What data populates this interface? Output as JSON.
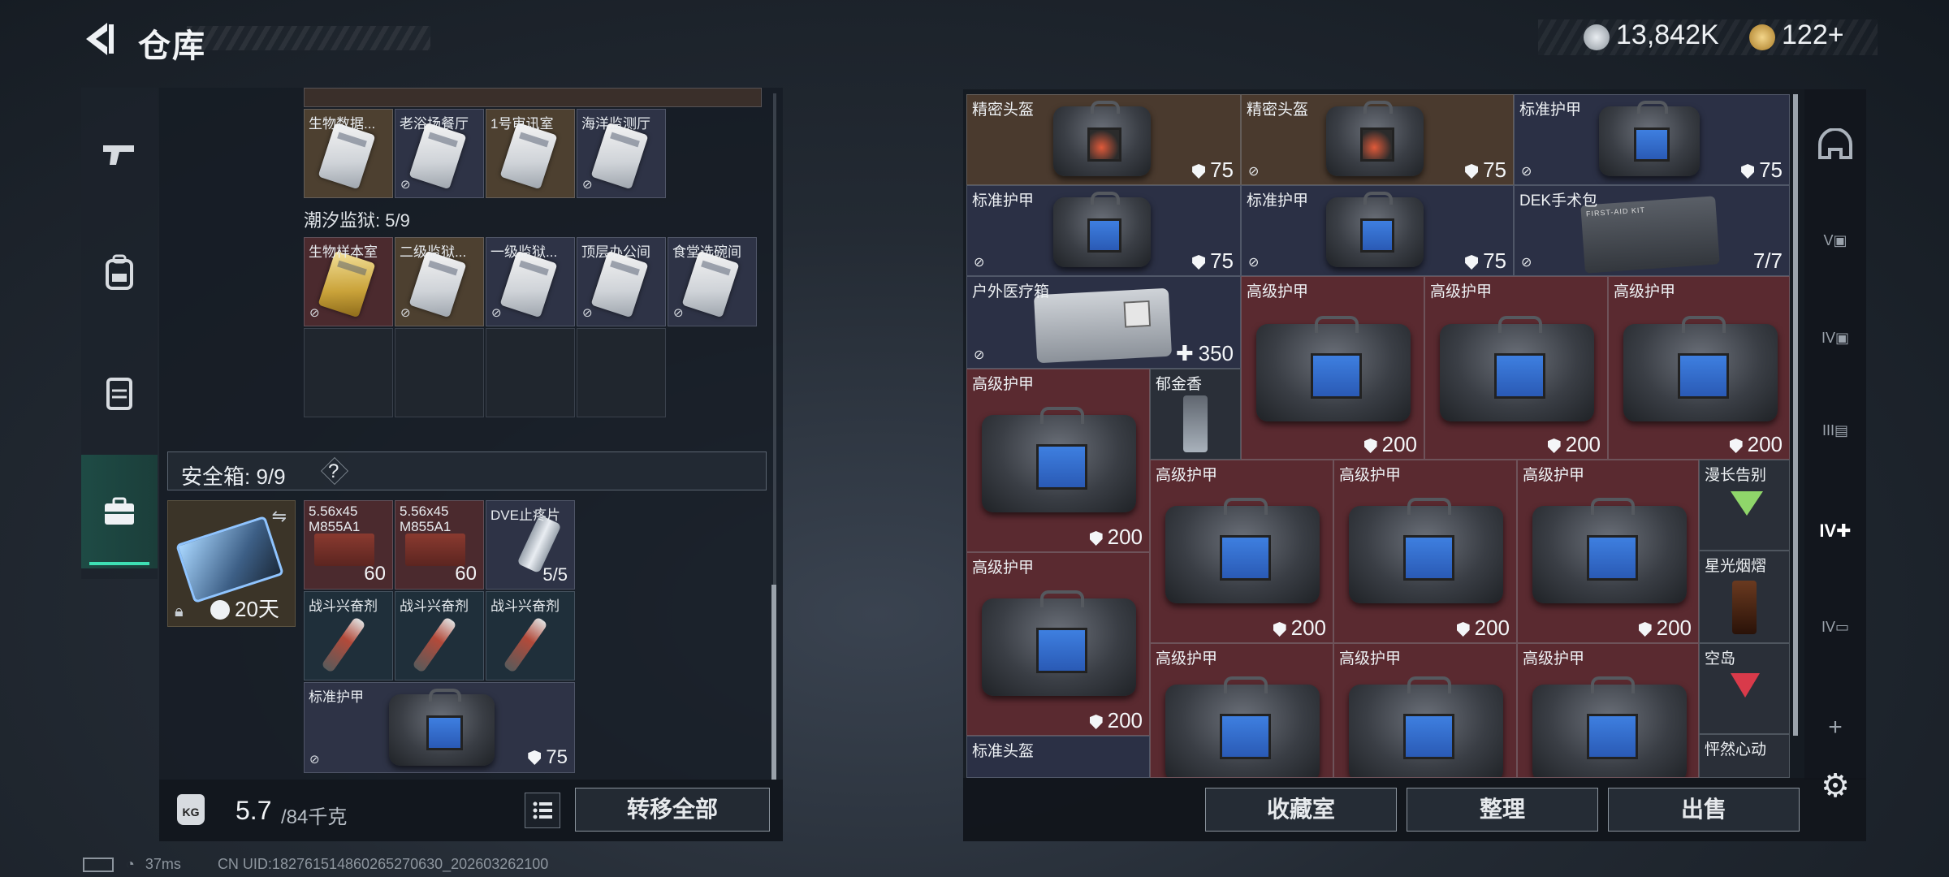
{
  "header": {
    "title": "仓库",
    "currency_main": "13,842K",
    "currency_premium": "122+"
  },
  "left_nav": [
    "gun-icon",
    "backpack-icon",
    "vest-icon",
    "briefcase-icon"
  ],
  "keycards_top": [
    {
      "name": "生物数据...",
      "color": "silver",
      "bg": "gold"
    },
    {
      "name": "老浴场餐厅",
      "color": "silver",
      "bg": "blue"
    },
    {
      "name": "1号审讯室",
      "color": "silver",
      "bg": "gold"
    },
    {
      "name": "海洋监测厅",
      "color": "silver",
      "bg": "blue"
    }
  ],
  "prison_section": {
    "label": "潮汐监狱: 5/9",
    "cards": [
      {
        "name": "生物样本室",
        "color": "gold",
        "bg": "red"
      },
      {
        "name": "二级监狱...",
        "color": "silver",
        "bg": "gold"
      },
      {
        "name": "一级监狱...",
        "color": "silver",
        "bg": "blue"
      },
      {
        "name": "顶层办公间",
        "color": "silver",
        "bg": "blue"
      },
      {
        "name": "食堂选碗间",
        "color": "silver",
        "bg": "blue"
      }
    ]
  },
  "safe_box": {
    "label": "安全箱: 9/9",
    "help": "?",
    "timer": "20天",
    "items": [
      {
        "name": "5.56x45 M855A1",
        "qty": "60"
      },
      {
        "name": "5.56x45 M855A1",
        "qty": "60"
      },
      {
        "name": "DVE止疼片",
        "qty": "5/5"
      },
      {
        "name": "战斗兴奋剂",
        "qty": ""
      },
      {
        "name": "战斗兴奋剂",
        "qty": ""
      },
      {
        "name": "战斗兴奋剂",
        "qty": ""
      }
    ],
    "armor": {
      "name": "标准护甲",
      "value": "75"
    }
  },
  "weight": {
    "value": "5.7",
    "unit": "/84千克",
    "icon_label": "KG"
  },
  "buttons": {
    "transfer_all": "转移全部",
    "collection": "收藏室",
    "organize": "整理",
    "sell": "出售"
  },
  "right_items": {
    "row1": [
      {
        "name": "精密头盔",
        "value": "75"
      },
      {
        "name": "精密头盔",
        "value": "75"
      },
      {
        "name": "标准护甲",
        "value": "75"
      }
    ],
    "row2": [
      {
        "name": "标准护甲",
        "value": "75"
      },
      {
        "name": "标准护甲",
        "value": "75"
      },
      {
        "name": "DEK手术包",
        "value": "7/7",
        "kit_label": "FIRST-AID KIT"
      }
    ],
    "medkit": {
      "name": "户外医疗箱",
      "value": "350"
    },
    "high_armor_label": "高级护甲",
    "high_armor_value": "200",
    "drinks": [
      "郁金香",
      "漫长告别",
      "星光烟熠",
      "空岛",
      "怦然心动"
    ],
    "bottom_helmet": "标准头盔"
  },
  "right_nav": [
    "helmet-icon",
    "V",
    "IV",
    "III",
    "IV+",
    "IV"
  ],
  "status": {
    "ping": "37ms",
    "uid": "CN UID:182761514860265270630_202603262100"
  },
  "colors": {
    "accent": "#3ee0b4",
    "rare_red": "#5a2a30",
    "rare_blue": "#2b3045"
  }
}
